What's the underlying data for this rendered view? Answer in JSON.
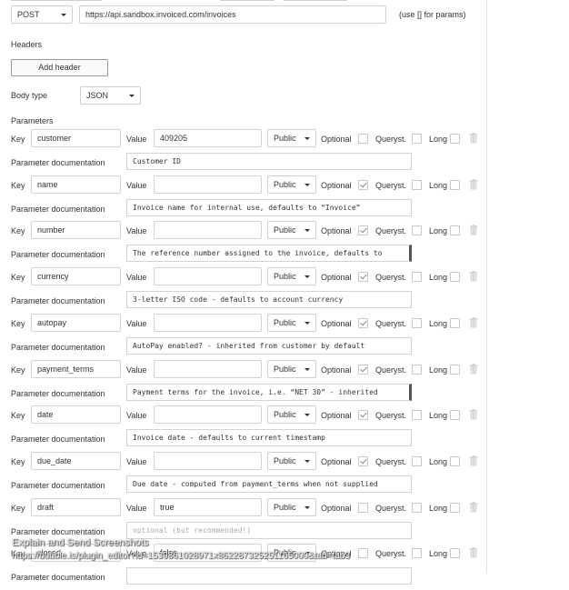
{
  "request": {
    "method": "POST",
    "url": "https://api.sandbox.invoiced.com/invoices",
    "params_hint": "(use [] for params)"
  },
  "headers": {
    "title": "Headers",
    "add_button": "Add header"
  },
  "body_type": {
    "label": "Body type",
    "value": "JSON"
  },
  "parameters": {
    "title": "Parameters",
    "labels": {
      "key": "Key",
      "value": "Value",
      "doc": "Parameter documentation",
      "optional": "Optional",
      "queryst": "Queryst.",
      "long": "Long"
    },
    "items": [
      {
        "key": "customer",
        "value": "409205",
        "visibility": "Public",
        "optional": false,
        "queryst": false,
        "long": false,
        "doc": "Customer ID",
        "doc_placeholder": false
      },
      {
        "key": "name",
        "value": "",
        "visibility": "Public",
        "optional": true,
        "queryst": false,
        "long": false,
        "doc": "Invoice name for internal use, defaults to “Invoice”",
        "doc_placeholder": false
      },
      {
        "key": "number",
        "value": "",
        "visibility": "Public",
        "optional": true,
        "queryst": false,
        "long": false,
        "doc": "The reference number assigned to the invoice, defaults to",
        "doc_placeholder": false
      },
      {
        "key": "currency",
        "value": "",
        "visibility": "Public",
        "optional": true,
        "queryst": false,
        "long": false,
        "doc": "3-letter ISO code - defaults to account currency",
        "doc_placeholder": false
      },
      {
        "key": "autopay",
        "value": "",
        "visibility": "Public",
        "optional": true,
        "queryst": false,
        "long": false,
        "doc": "AutoPay enabled? - inherited from customer by default",
        "doc_placeholder": false
      },
      {
        "key": "payment_terms",
        "value": "",
        "visibility": "Public",
        "optional": true,
        "queryst": false,
        "long": false,
        "doc": "Payment terms for the invoice, i.e. “NET 30” - inherited",
        "doc_placeholder": false
      },
      {
        "key": "date",
        "value": "",
        "visibility": "Public",
        "optional": true,
        "queryst": false,
        "long": false,
        "doc": "Invoice date - defaults to current timestamp",
        "doc_placeholder": false
      },
      {
        "key": "due_date",
        "value": "",
        "visibility": "Public",
        "optional": true,
        "queryst": false,
        "long": false,
        "doc": "Due date - computed from payment_terms when not supplied",
        "doc_placeholder": false
      },
      {
        "key": "draft",
        "value": "true",
        "visibility": "Public",
        "optional": false,
        "queryst": false,
        "long": false,
        "doc": "optional (but recommended!)",
        "doc_placeholder": true
      },
      {
        "key": "closed",
        "value": "false",
        "visibility": "Public",
        "optional": false,
        "queryst": false,
        "long": false,
        "doc": "",
        "doc_placeholder": false
      }
    ]
  },
  "overlay": {
    "title": "Explain and Send Screenshots",
    "url": "https://bubble.is/plugin_editor?id=1539861028971x862287325251165000&tab=tab3"
  }
}
